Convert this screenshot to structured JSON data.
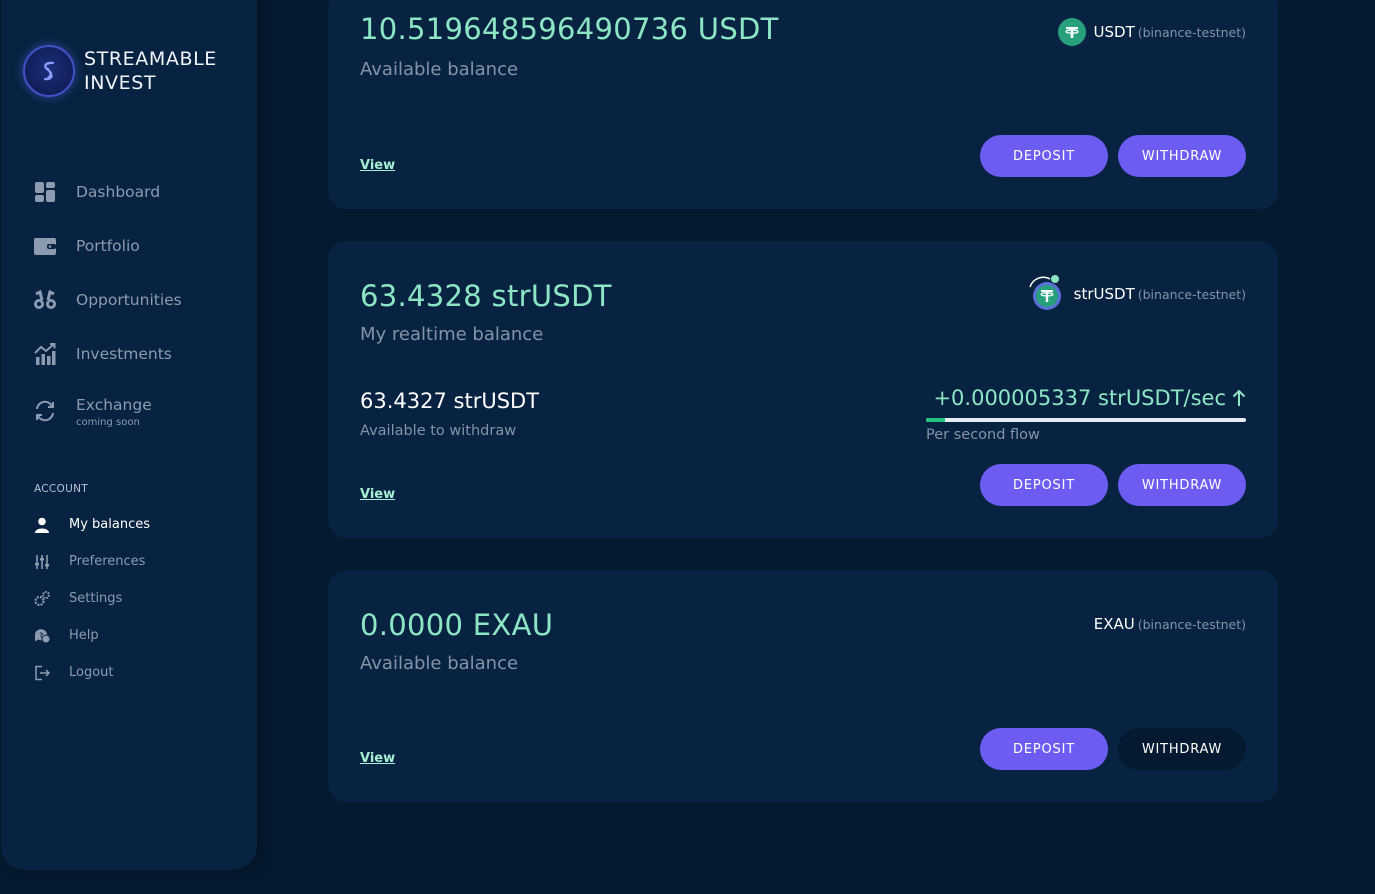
{
  "brand": {
    "line1": "STREAMABLE",
    "line2": "INVEST"
  },
  "nav": {
    "dashboard": "Dashboard",
    "portfolio": "Portfolio",
    "opportunities": "Opportunities",
    "investments": "Investments",
    "exchange": "Exchange",
    "exchange_sub": "coming soon"
  },
  "account": {
    "heading": "ACCOUNT",
    "my_balances": "My balances",
    "preferences": "Preferences",
    "settings": "Settings",
    "help": "Help",
    "logout": "Logout"
  },
  "cards": [
    {
      "amount": "10.519648596490736 USDT",
      "subtitle": "Available balance",
      "token": "USDT",
      "network": "(binance-testnet)",
      "view": "View",
      "deposit": "DEPOSIT",
      "withdraw": "WITHDRAW"
    },
    {
      "amount": "63.4328 strUSDT",
      "subtitle": "My realtime balance",
      "token": "strUSDT",
      "network": "(binance-testnet)",
      "withdrawable": "63.4327 strUSDT",
      "withdrawable_label": "Available to withdraw",
      "flow": "+0.000005337 strUSDT/sec",
      "flow_label": "Per second flow",
      "flow_progress": 0.06,
      "view": "View",
      "deposit": "DEPOSIT",
      "withdraw": "WITHDRAW"
    },
    {
      "amount": "0.0000 EXAU",
      "subtitle": "Available balance",
      "token": "EXAU",
      "network": "(binance-testnet)",
      "view": "View",
      "deposit": "DEPOSIT",
      "withdraw": "WITHDRAW"
    }
  ],
  "colors": {
    "accent": "#6c5cf2",
    "positive": "#8ce6c4",
    "tether": "#26a17b"
  }
}
